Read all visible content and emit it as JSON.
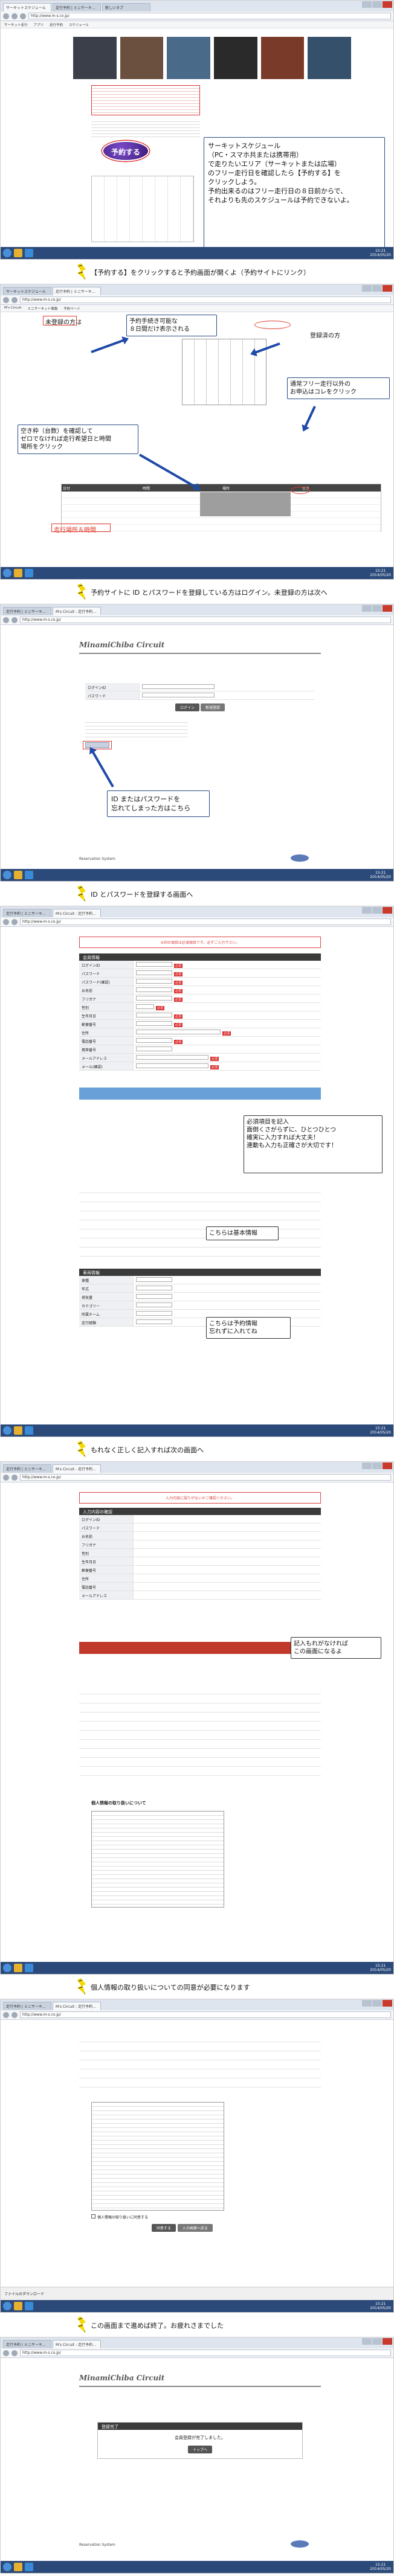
{
  "browser": {
    "address": "http://www.m-s.co.jp/",
    "tabs": [
      "サーキットスケジュール",
      "走行予約 | ミニサーキ…",
      "M's Circuit - 走行予約…",
      "新しいタブ"
    ],
    "bookmarks": [
      "サーキット走行",
      "アプリ",
      "走行予約",
      "スケジュール",
      "M's Circuit",
      "ミニサーキット情報",
      "予約ページ",
      "その他のブックマーク"
    ],
    "clock_time": "15:21",
    "clock_date": "2014/05/20"
  },
  "step1": {
    "reserve_button": "予約する",
    "callout": [
      "サーキットスケジュール",
      "（PC・スマホ共または携帯用）",
      "で走りたいエリア（サーキットまたは広場）",
      "のフリー走行日を確認したら【予約する】を",
      "クリックしよう。",
      "予約出来るのはフリー走行日の８日前からで、",
      "それよりも先のスケジュールは予約できないよ。"
    ]
  },
  "caption1": "【予約する】をクリックすると予約画面が開くよ（予約サイトにリンク）",
  "step2": {
    "label_unregistered": "未登録の方は",
    "label_registered": "登録済の方",
    "callout_days": [
      "予約手続き可能な",
      "８日間だけ表示される"
    ],
    "callout_other": [
      "通常フリー走行以外の",
      "お申込はコレをクリック"
    ],
    "callout_slots": [
      "空き枠（台数）を確認して",
      "ゼロでなければ走行希望日と時間",
      "場所をクリック"
    ],
    "run_place_label": "走行場所＆時間",
    "table_headers": [
      "日付",
      "時間",
      "場所",
      "空き"
    ]
  },
  "caption2": "予約サイトに ID とパスワードを登録している方はログイン。未登録の方は次へ",
  "step3": {
    "logo": "MinamiChiba Circuit",
    "login_id_label": "ログインID",
    "password_label": "パスワード",
    "login_button": "ログイン",
    "register_button": "新規登録",
    "callout": [
      "ID またはパスワードを",
      "忘れてしまった方はこちら"
    ],
    "footer": "Reservation System"
  },
  "caption3": "ID とパスワードを登録する画面へ",
  "step4": {
    "notice": "※印の項目は必須項目です。必ずご入力下さい。",
    "section_member": "会員情報",
    "labels": [
      "ログインID",
      "パスワード",
      "パスワード(確認)",
      "お名前",
      "フリガナ",
      "性別",
      "生年月日",
      "郵便番号",
      "住所",
      "電話番号",
      "携帯番号",
      "メールアドレス",
      "メール(確認)"
    ],
    "required": "必須",
    "callout_required": [
      "必須項目を記入",
      "面倒くさがらずに、ひとつひとつ",
      "確実に入力すれば大丈夫！",
      "連動も入力も正確さが大切です！"
    ],
    "callout_basic": "こちらは基本情報",
    "section_vehicle": "車両情報",
    "vehicle_labels": [
      "車種",
      "年式",
      "排気量",
      "カテゴリー",
      "所属チーム",
      "走行経験"
    ],
    "callout_vehicle": [
      "こちらは予約情報",
      "忘れずに入れてね"
    ]
  },
  "caption4": "もれなく正しく記入すれば次の画面へ",
  "step5": {
    "notice": "入力内容に誤りがないかご確認ください。",
    "section_confirm": "入力内容の確認",
    "rows": [
      "ログインID",
      "パスワード",
      "お名前",
      "フリガナ",
      "性別",
      "生年月日",
      "郵便番号",
      "住所",
      "電話番号",
      "メールアドレス"
    ],
    "callout_confirm": [
      "記入もれがなければ",
      "この画面になるよ"
    ],
    "privacy_title": "個人情報の取り扱いについて"
  },
  "caption5": "個人情報の取り扱いについての同意が必要になります",
  "step6": {
    "agree_text": "個人情報の取り扱いに同意する",
    "agree_button": "同意する",
    "back_button": "入力画面へ戻る",
    "download_bar": "ファイルのダウンロード"
  },
  "caption6": "この画面まで進めば終了。お疲れさまでした",
  "step7": {
    "logo": "MinamiChiba Circuit",
    "complete_title": "登録完了",
    "complete_msg": "会員登録が完了しました。",
    "top_button": "トップへ",
    "footer": "Reservation System"
  }
}
